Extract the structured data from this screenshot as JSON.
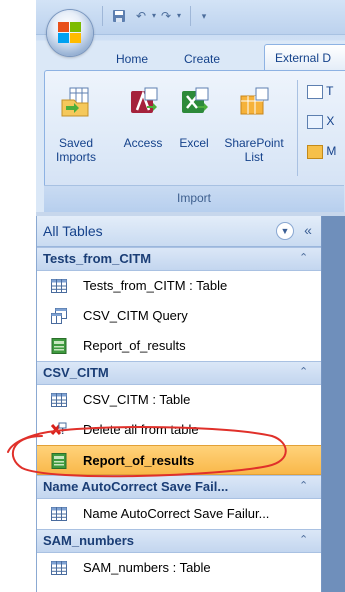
{
  "ribbon": {
    "tabs": [
      {
        "label": "Home"
      },
      {
        "label": "Create"
      },
      {
        "label": "External D"
      }
    ],
    "buttons": {
      "saved_imports_line1": "Saved",
      "saved_imports_line2": "Imports",
      "access": "Access",
      "excel": "Excel",
      "sharepoint_line1": "SharePoint",
      "sharepoint_line2": "List",
      "small1": "T",
      "small2": "X",
      "small3": "M"
    },
    "group_label": "Import"
  },
  "nav": {
    "title": "All Tables",
    "groups": [
      {
        "name": "Tests_from_CITM",
        "items": [
          {
            "label": "Tests_from_CITM : Table",
            "icon": "table-icon"
          },
          {
            "label": "CSV_CITM Query",
            "icon": "query-icon"
          },
          {
            "label": "Report_of_results",
            "icon": "report-icon"
          }
        ]
      },
      {
        "name": "CSV_CITM",
        "items": [
          {
            "label": "CSV_CITM : Table",
            "icon": "table-icon"
          },
          {
            "label": "Delete all from table",
            "icon": "delete-query-icon"
          },
          {
            "label": "Report_of_results",
            "icon": "report-icon",
            "selected": true
          }
        ]
      },
      {
        "name": "Name AutoCorrect Save Fail...",
        "items": [
          {
            "label": "Name AutoCorrect Save Failur...",
            "icon": "table-icon"
          }
        ]
      },
      {
        "name": "SAM_numbers",
        "items": [
          {
            "label": "SAM_numbers : Table",
            "icon": "table-icon"
          }
        ]
      }
    ]
  },
  "colors": {
    "selected_fill": "#f9b84a",
    "annotation_stroke": "#e0302a",
    "group_text": "#1b3e76"
  }
}
